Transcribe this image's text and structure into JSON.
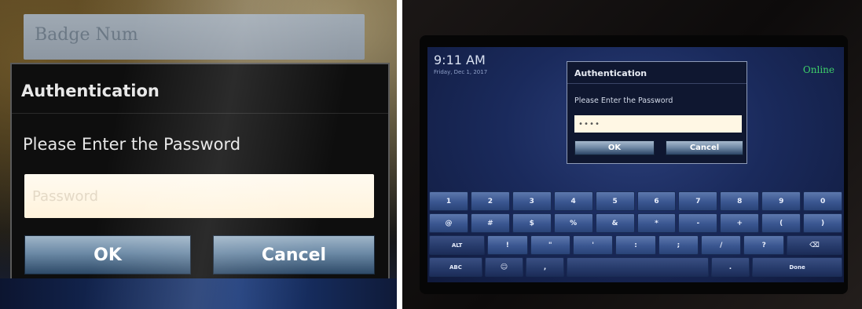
{
  "left": {
    "badge_placeholder": "Badge Num",
    "dialog": {
      "title": "Authentication",
      "prompt": "Please Enter the Password",
      "password_placeholder": "Password",
      "ok_label": "OK",
      "cancel_label": "Cancel"
    }
  },
  "right": {
    "header": {
      "time": "9:11 AM",
      "date": "Friday, Dec 1, 2017",
      "status": "Online"
    },
    "dialog": {
      "title": "Authentication",
      "prompt": "Please Enter the Password",
      "password_value": "••••",
      "ok_label": "OK",
      "cancel_label": "Cancel"
    },
    "keyboard": {
      "rows": [
        [
          "1",
          "2",
          "3",
          "4",
          "5",
          "6",
          "7",
          "8",
          "9",
          "0"
        ],
        [
          "@",
          "#",
          "$",
          "%",
          "&",
          "*",
          "-",
          "+",
          "(",
          ")"
        ],
        [
          "ALT",
          "!",
          "\"",
          "'",
          ":",
          ";",
          "/",
          "?",
          "⌫"
        ],
        [
          "ABC",
          "☺",
          ",",
          "",
          ".",
          "Done"
        ]
      ]
    }
  },
  "colors": {
    "button_gradient_top": "#9fb5c8",
    "button_gradient_bottom": "#2e4a68",
    "status_online": "#3ed06a",
    "key_blue": "#3a5690"
  }
}
